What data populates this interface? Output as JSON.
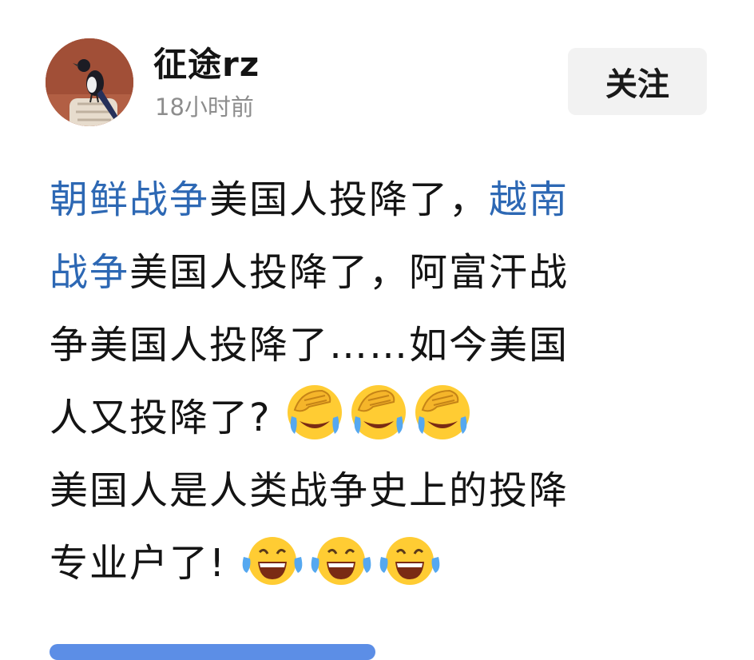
{
  "post_header": {
    "username": "征途rz",
    "timestamp": "18小时前",
    "follow_label": "关注",
    "avatar_icon": "magpie-avatar-icon"
  },
  "post_body": {
    "l1_topic1": "朝鲜战争",
    "l1_text": "美国人投降了，",
    "l1_topic2": "越南",
    "l2_topic": "战争",
    "l2_text": "美国人投降了，阿富汗战",
    "l3_text": "争美国人投降了……如今美国",
    "l4_text": "人又投降了?",
    "l5_text": "美国人是人类战争史上的投降",
    "l6_text": "专业户了!"
  },
  "emojis": {
    "facepalm": "facepalm-laugh-emoji",
    "laugh": "laugh-tears-emoji"
  },
  "colors": {
    "topic_link": "#2d68b4",
    "timestamp": "#8d8d8d",
    "follow_bg": "#f2f2f2"
  }
}
